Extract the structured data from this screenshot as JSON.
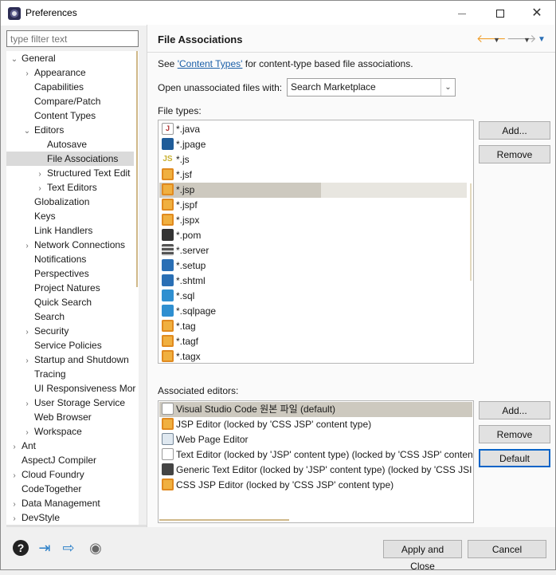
{
  "window": {
    "title": "Preferences"
  },
  "filter": {
    "placeholder": "type filter text"
  },
  "tree": [
    {
      "label": "General",
      "chev": "⌄",
      "indent": 0,
      "name": "tree-item-general"
    },
    {
      "label": "Appearance",
      "chev": "›",
      "indent": 1,
      "name": "tree-item-appearance"
    },
    {
      "label": "Capabilities",
      "chev": "",
      "indent": 1,
      "name": "tree-item-capabilities"
    },
    {
      "label": "Compare/Patch",
      "chev": "",
      "indent": 1,
      "name": "tree-item-compare-patch"
    },
    {
      "label": "Content Types",
      "chev": "",
      "indent": 1,
      "name": "tree-item-content-types"
    },
    {
      "label": "Editors",
      "chev": "⌄",
      "indent": 1,
      "name": "tree-item-editors"
    },
    {
      "label": "Autosave",
      "chev": "",
      "indent": 2,
      "name": "tree-item-autosave"
    },
    {
      "label": "File Associations",
      "chev": "",
      "indent": 2,
      "name": "tree-item-file-associations",
      "selected": true
    },
    {
      "label": "Structured Text Edit",
      "chev": "›",
      "indent": 2,
      "name": "tree-item-structured-text-editors"
    },
    {
      "label": "Text Editors",
      "chev": "›",
      "indent": 2,
      "name": "tree-item-text-editors"
    },
    {
      "label": "Globalization",
      "chev": "",
      "indent": 1,
      "name": "tree-item-globalization"
    },
    {
      "label": "Keys",
      "chev": "",
      "indent": 1,
      "name": "tree-item-keys"
    },
    {
      "label": "Link Handlers",
      "chev": "",
      "indent": 1,
      "name": "tree-item-link-handlers"
    },
    {
      "label": "Network Connections",
      "chev": "›",
      "indent": 1,
      "name": "tree-item-network-connections"
    },
    {
      "label": "Notifications",
      "chev": "",
      "indent": 1,
      "name": "tree-item-notifications"
    },
    {
      "label": "Perspectives",
      "chev": "",
      "indent": 1,
      "name": "tree-item-perspectives"
    },
    {
      "label": "Project Natures",
      "chev": "",
      "indent": 1,
      "name": "tree-item-project-natures"
    },
    {
      "label": "Quick Search",
      "chev": "",
      "indent": 1,
      "name": "tree-item-quick-search"
    },
    {
      "label": "Search",
      "chev": "",
      "indent": 1,
      "name": "tree-item-search"
    },
    {
      "label": "Security",
      "chev": "›",
      "indent": 1,
      "name": "tree-item-security"
    },
    {
      "label": "Service Policies",
      "chev": "",
      "indent": 1,
      "name": "tree-item-service-policies"
    },
    {
      "label": "Startup and Shutdown",
      "chev": "›",
      "indent": 1,
      "name": "tree-item-startup-shutdown"
    },
    {
      "label": "Tracing",
      "chev": "",
      "indent": 1,
      "name": "tree-item-tracing"
    },
    {
      "label": "UI Responsiveness Mor",
      "chev": "",
      "indent": 1,
      "name": "tree-item-ui-responsiveness"
    },
    {
      "label": "User Storage Service",
      "chev": "›",
      "indent": 1,
      "name": "tree-item-user-storage-service"
    },
    {
      "label": "Web Browser",
      "chev": "",
      "indent": 1,
      "name": "tree-item-web-browser"
    },
    {
      "label": "Workspace",
      "chev": "›",
      "indent": 1,
      "name": "tree-item-workspace"
    },
    {
      "label": "Ant",
      "chev": "›",
      "indent": 0,
      "name": "tree-item-ant"
    },
    {
      "label": "AspectJ Compiler",
      "chev": "",
      "indent": 0,
      "name": "tree-item-aspectj-compiler"
    },
    {
      "label": "Cloud Foundry",
      "chev": "›",
      "indent": 0,
      "name": "tree-item-cloud-foundry"
    },
    {
      "label": "CodeTogether",
      "chev": "",
      "indent": 0,
      "name": "tree-item-codetogether"
    },
    {
      "label": "Data Management",
      "chev": "›",
      "indent": 0,
      "name": "tree-item-data-management"
    },
    {
      "label": "DevStyle",
      "chev": "›",
      "indent": 0,
      "name": "tree-item-devstyle"
    }
  ],
  "page": {
    "title": "File Associations",
    "see_prefix": "See ",
    "see_link": "'Content Types'",
    "see_suffix": " for content-type based file associations.",
    "open_label": "Open unassociated files with:",
    "open_value": "Search Marketplace",
    "file_types_label": "File types:",
    "assoc_label": "Associated editors:"
  },
  "file_types": [
    {
      "label": "*.java",
      "icon": "java",
      "icon_name": "java-file-icon",
      "glyph": "J"
    },
    {
      "label": "*.jpage",
      "icon": "jpage",
      "icon_name": "jpage-file-icon",
      "glyph": ""
    },
    {
      "label": "*.js",
      "icon": "js",
      "icon_name": "js-file-icon",
      "glyph": "JS"
    },
    {
      "label": "*.jsf",
      "icon": "globe",
      "icon_name": "jsf-file-icon",
      "glyph": ""
    },
    {
      "label": "*.jsp",
      "icon": "globe",
      "icon_name": "jsp-file-icon",
      "glyph": "",
      "selected": true
    },
    {
      "label": "*.jspf",
      "icon": "globe",
      "icon_name": "jspf-file-icon",
      "glyph": ""
    },
    {
      "label": "*.jspx",
      "icon": "globe",
      "icon_name": "jspx-file-icon",
      "glyph": ""
    },
    {
      "label": "*.pom",
      "icon": "pom",
      "icon_name": "pom-file-icon",
      "glyph": ""
    },
    {
      "label": "*.server",
      "icon": "server",
      "icon_name": "server-file-icon",
      "glyph": ""
    },
    {
      "label": "*.setup",
      "icon": "setup",
      "icon_name": "setup-file-icon",
      "glyph": ""
    },
    {
      "label": "*.shtml",
      "icon": "shtml",
      "icon_name": "shtml-file-icon",
      "glyph": ""
    },
    {
      "label": "*.sql",
      "icon": "sql",
      "icon_name": "sql-file-icon",
      "glyph": ""
    },
    {
      "label": "*.sqlpage",
      "icon": "sql",
      "icon_name": "sqlpage-file-icon",
      "glyph": ""
    },
    {
      "label": "*.tag",
      "icon": "globe",
      "icon_name": "tag-file-icon",
      "glyph": ""
    },
    {
      "label": "*.tagf",
      "icon": "globe",
      "icon_name": "tagf-file-icon",
      "glyph": ""
    },
    {
      "label": "*.tagx",
      "icon": "globe",
      "icon_name": "tagx-file-icon",
      "glyph": ""
    }
  ],
  "editors": [
    {
      "label": "Visual Studio Code 원본 파일 (default)",
      "icon": "doc",
      "icon_name": "vscode-editor-icon",
      "selected": true
    },
    {
      "label": "JSP Editor (locked by 'CSS JSP' content type)",
      "icon": "globe",
      "icon_name": "jsp-editor-icon"
    },
    {
      "label": "Web Page Editor",
      "icon": "webpage",
      "icon_name": "web-page-editor-icon"
    },
    {
      "label": "Text Editor (locked by 'JSP' content type) (locked by 'CSS JSP' conten",
      "icon": "doc",
      "icon_name": "text-editor-icon"
    },
    {
      "label": "Generic Text Editor (locked by 'JSP' content type) (locked by 'CSS JSI",
      "icon": "generic",
      "icon_name": "generic-text-editor-icon"
    },
    {
      "label": "CSS JSP Editor (locked by 'CSS JSP' content type)",
      "icon": "globe",
      "icon_name": "css-jsp-editor-icon"
    }
  ],
  "buttons": {
    "add": "Add...",
    "remove": "Remove",
    "default": "Default",
    "apply_close": "Apply and Close",
    "cancel": "Cancel"
  },
  "icons": {
    "back": "back-arrow-icon",
    "forward": "forward-arrow-icon",
    "menu": "view-menu-icon",
    "help": "help-icon",
    "import": "import-icon",
    "export": "export-icon",
    "record": "record-icon"
  }
}
